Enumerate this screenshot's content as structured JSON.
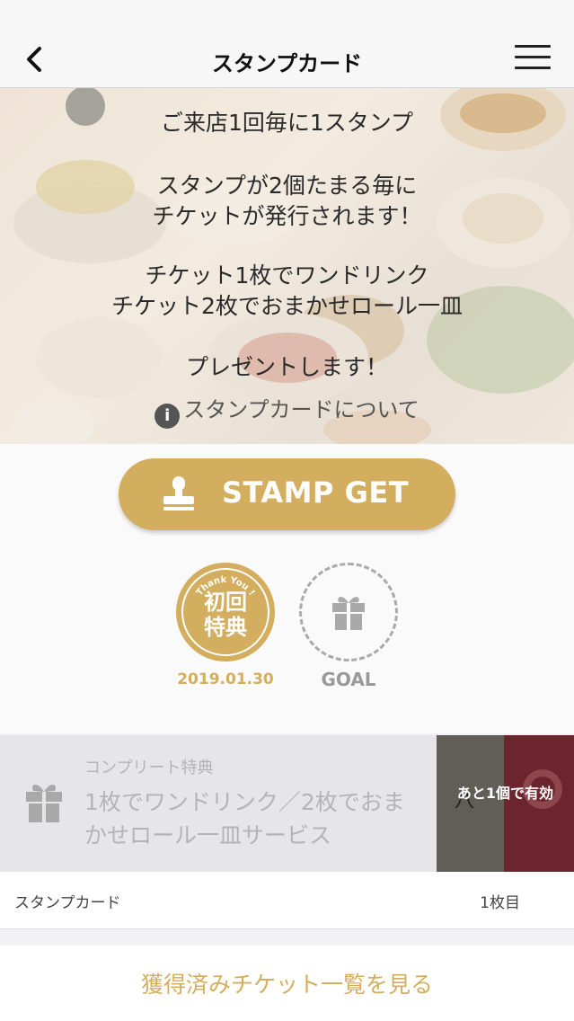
{
  "navbar": {
    "title": "スタンプカード"
  },
  "hero": {
    "lines": [
      "ご来店1回毎に1スタンプ",
      "スタンプが2個たまる毎に",
      "チケットが発行されます！",
      "チケット1枚でワンドリンク",
      "チケット2枚でおまかせロール一皿",
      "プレゼントします！"
    ],
    "info_link": "スタンプカードについて"
  },
  "stamp_button": {
    "label": "STAMP GET"
  },
  "stamps": {
    "first": {
      "arc_text": "Thank You !",
      "kanji_top": "初回",
      "kanji_bottom": "特典",
      "date": "2019.01.30"
    },
    "goal": {
      "label": "GOAL"
    }
  },
  "complete": {
    "heading": "コンプリート特典",
    "text": "1枚でワンドリンク／2枚でおまかせロール一皿サービス",
    "badge": "あと1個で有効"
  },
  "card_row": {
    "label": "スタンプカード",
    "value": "1枚目"
  },
  "ticket_link": {
    "label": "獲得済みチケット一覧を見る"
  },
  "colors": {
    "gold": "#d4ae5f",
    "muted_text": "#b4b4b4"
  }
}
